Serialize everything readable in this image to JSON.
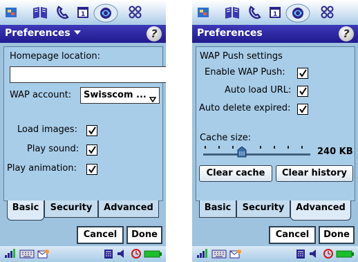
{
  "screens": {
    "left": {
      "title": "Preferences",
      "homepage_label": "Homepage location:",
      "homepage_value": "",
      "wap_label": "WAP account:",
      "wap_value": "Swisscom ...",
      "load_images_label": "Load images:",
      "play_sound_label": "Play sound:",
      "play_animation_label": "Play animation:",
      "load_images_checked": true,
      "play_sound_checked": true,
      "play_animation_checked": true,
      "active_tab": "Basic"
    },
    "right": {
      "title": "Preferences",
      "section_label": "WAP Push settings",
      "enable_push_label": "Enable WAP Push:",
      "auto_load_label": "Auto load URL:",
      "auto_delete_label": "Auto delete expired:",
      "enable_push_checked": true,
      "auto_load_checked": true,
      "auto_delete_checked": true,
      "cache_label": "Cache size:",
      "cache_value": "240 KB",
      "clear_cache_label": "Clear cache",
      "clear_history_label": "Clear history",
      "active_tab": "Advanced"
    }
  },
  "tabs": [
    "Basic",
    "Security",
    "Advanced"
  ],
  "buttons": {
    "cancel": "Cancel",
    "done": "Done"
  },
  "colors": {
    "screen_bg": "#9ec3df",
    "titlebar": "#2a248f",
    "accent_green": "#1bbf2a"
  }
}
